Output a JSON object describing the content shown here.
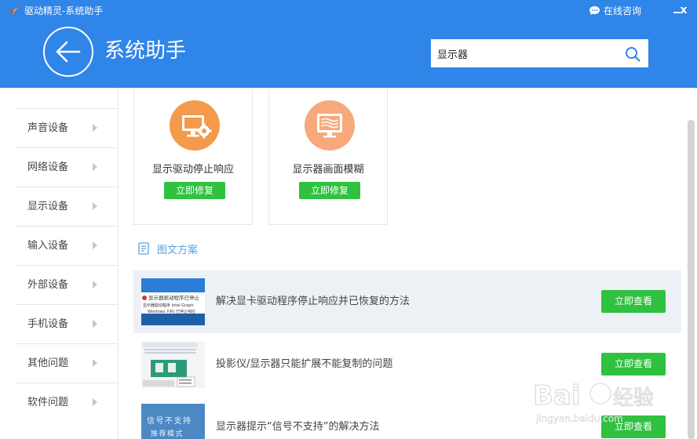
{
  "window": {
    "title": "驱动精灵-系统助手",
    "chat_label": "在线咨询",
    "close_glyph": "x"
  },
  "header": {
    "title": "系统助手",
    "search": {
      "value": "显示器",
      "placeholder": ""
    }
  },
  "sidebar": {
    "items": [
      {
        "label": "声音设备"
      },
      {
        "label": "网络设备"
      },
      {
        "label": "显示设备"
      },
      {
        "label": "输入设备"
      },
      {
        "label": "外部设备"
      },
      {
        "label": "手机设备"
      },
      {
        "label": "其他问题"
      },
      {
        "label": "软件问题"
      }
    ]
  },
  "cards": [
    {
      "title": "显示驱动停止响应",
      "button": "立即修复",
      "icon": "monitor-gear-icon",
      "color": "#f39a4b"
    },
    {
      "title": "显示器画面模糊",
      "button": "立即修复",
      "icon": "monitor-blur-icon",
      "color": "#f7a97c"
    }
  ],
  "section": {
    "title": "图文方案",
    "icon": "document-icon"
  },
  "articles": [
    {
      "title": "解决显卡驱动程序停止响应并已恢复的方法",
      "button": "立即查看",
      "thumb_lines": [
        "显示器驱动程序已停止",
        "显示器驱动程序 Intel Graph",
        "Windows 7(R) 已停止响应"
      ]
    },
    {
      "title": "投影仪/显示器只能扩展不能复制的问题",
      "button": "立即查看",
      "thumb_lines": []
    },
    {
      "title": "显示器提示“信号不支持”的解决方法",
      "button": "立即查看",
      "thumb_lines": [
        "信号不支持",
        "推荐模式"
      ]
    }
  ],
  "watermark": {
    "brand": "Baidu经验",
    "url": "jingyan.baidu.com"
  },
  "colors": {
    "header_blue": "#2f85e8",
    "button_green": "#2fc13f",
    "link_blue": "#5aa0e0"
  }
}
